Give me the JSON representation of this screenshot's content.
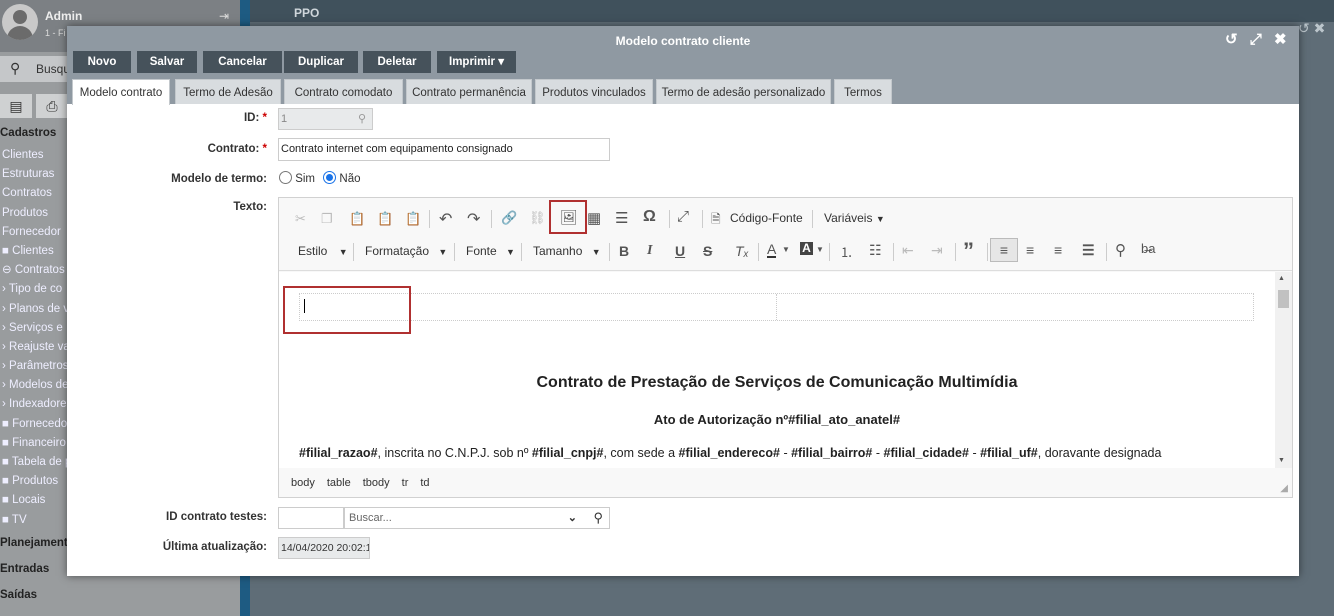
{
  "sidebar": {
    "user": "Admin",
    "user_sub": "1 - Fi",
    "search_placeholder": "Busqu",
    "menu": [
      {
        "label": "Cadastros",
        "bold": true
      },
      {
        "label": "Clientes"
      },
      {
        "label": "Estruturas"
      },
      {
        "label": "Contratos"
      },
      {
        "label": "Produtos"
      },
      {
        "label": "Fornecedor"
      },
      {
        "label": "■ Clientes"
      },
      {
        "label": "⊖ Contratos"
      },
      {
        "label": "› Tipo de co"
      },
      {
        "label": "› Planos de v"
      },
      {
        "label": "› Serviços e"
      },
      {
        "label": "› Reajuste va"
      },
      {
        "label": "› Parâmetros"
      },
      {
        "label": "› Modelos de"
      },
      {
        "label": "› Indexadore"
      },
      {
        "label": "■ Fornecedor"
      },
      {
        "label": "■ Financeiro"
      },
      {
        "label": "■ Tabela de p"
      },
      {
        "label": "■ Produtos"
      },
      {
        "label": "■ Locais"
      },
      {
        "label": "■ TV"
      },
      {
        "label": "Planejamento",
        "bold": true
      },
      {
        "label": "Entradas",
        "bold": true
      },
      {
        "label": "Saídas",
        "bold": true
      }
    ]
  },
  "background": {
    "title": "PPO"
  },
  "modal": {
    "title": "Modelo contrato cliente",
    "toolbar": [
      "Novo",
      "Salvar",
      "Cancelar",
      "Duplicar",
      "Deletar",
      "Imprimir ▾"
    ],
    "tabs": [
      "Modelo contrato",
      "Termo de Adesão",
      "Contrato comodato",
      "Contrato permanência",
      "Produtos vinculados",
      "Termo de adesão personalizado",
      "Termos"
    ],
    "form": {
      "id_label": "ID:",
      "id_value": "1",
      "contrato_label": "Contrato:",
      "contrato_value": "Contrato internet com equipamento consignado",
      "modelo_label": "Modelo de termo:",
      "opt_sim": "Sim",
      "opt_nao": "Não",
      "texto_label": "Texto:",
      "id_testes_label": "ID contrato testes:",
      "buscar_placeholder": "Buscar...",
      "ultima_label": "Última atualização:",
      "ultima_value": "14/04/2020 20:02:1"
    },
    "editor": {
      "codigo_fonte": "Código-Fonte",
      "variaveis": "Variáveis",
      "estilo": "Estilo",
      "formatacao": "Formatação",
      "fonte": "Fonte",
      "tamanho": "Tamanho",
      "heading": "Contrato de Prestação de Serviços de Comunicação Multimídia",
      "subheading": "Ato de Autorização nº#filial_ato_anatel#",
      "body_parts": [
        "#filial_razao#",
        ", inscrita no C.N.P.J. sob nº ",
        "#filial_cnpj#",
        ", com sede a ",
        "#filial_endereco#",
        " - ",
        "#filial_bairro#",
        " - ",
        "#filial_cidade#",
        " - ",
        "#filial_uf#",
        ", doravante designada"
      ],
      "status_path": [
        "body",
        "table",
        "tbody",
        "tr",
        "td"
      ]
    }
  }
}
